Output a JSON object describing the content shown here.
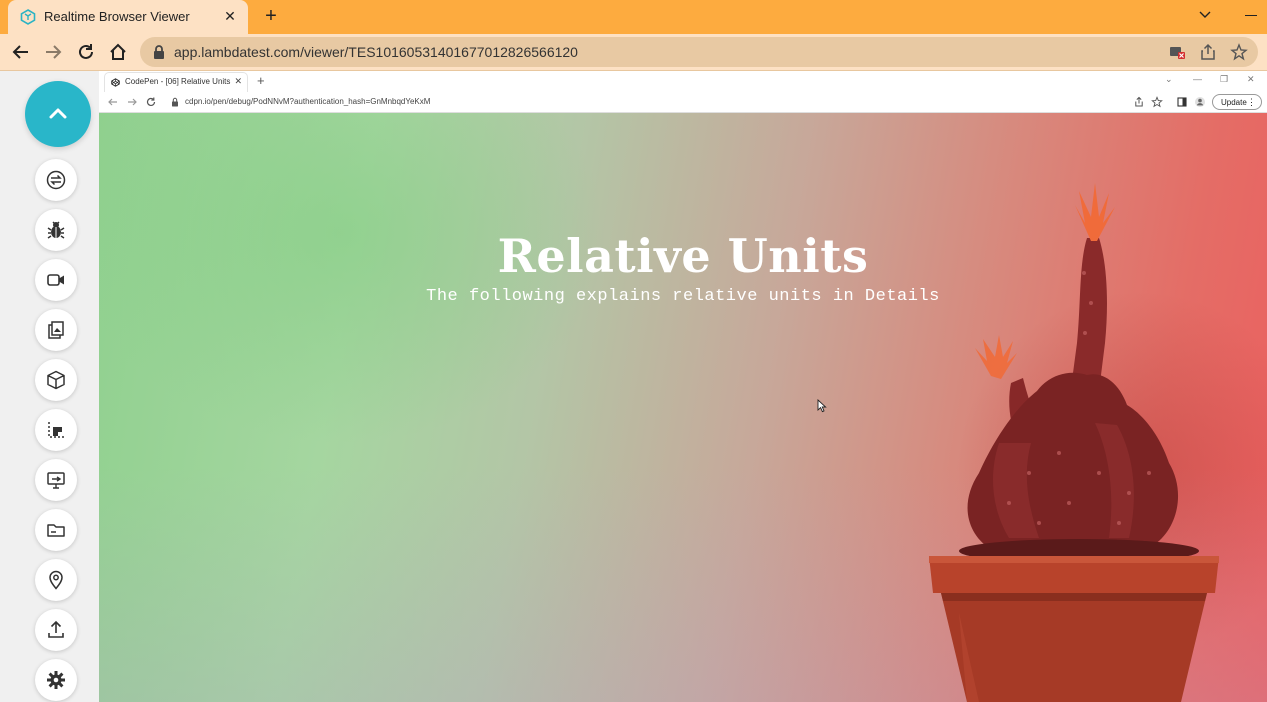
{
  "outer_browser": {
    "tab_title": "Realtime Browser Viewer",
    "url": "app.lambdatest.com/viewer/TES10160531401677012826566120",
    "colors": {
      "tabbar": "#fdab3f",
      "toolbar": "#fde1c4",
      "omnibox": "#e8c9a3"
    }
  },
  "sidebar": {
    "toggle_icon": "chevron-up-icon",
    "accent": "#29b6c9",
    "tools": [
      {
        "name": "switch-browser",
        "icon": "refresh-swap-icon"
      },
      {
        "name": "bug-report",
        "icon": "bug-icon"
      },
      {
        "name": "record-video",
        "icon": "video-camera-icon"
      },
      {
        "name": "screenshot-gallery",
        "icon": "gallery-icon"
      },
      {
        "name": "3d-box",
        "icon": "cube-icon"
      },
      {
        "name": "resolution",
        "icon": "crop-icon"
      },
      {
        "name": "remote-screen",
        "icon": "monitor-icon"
      },
      {
        "name": "files",
        "icon": "folder-icon"
      },
      {
        "name": "geolocation",
        "icon": "location-pin-icon"
      },
      {
        "name": "upload",
        "icon": "upload-icon"
      },
      {
        "name": "settings",
        "icon": "gear-icon"
      }
    ]
  },
  "inner_browser": {
    "tab_title": "CodePen - [06] Relative Units",
    "url": "cdpn.io/pen/debug/PodNNvM?authentication_hash=GnMnbqdYeKxM",
    "update_label": "Update"
  },
  "page": {
    "title": "Relative Units",
    "subtitle": "The following explains relative units in Details"
  }
}
